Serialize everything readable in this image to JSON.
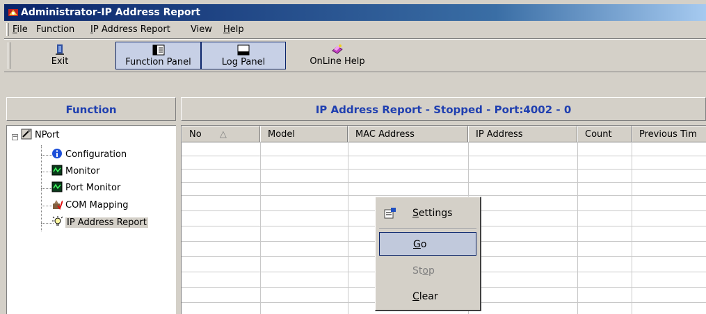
{
  "window": {
    "title": "Administrator-IP Address Report"
  },
  "menu": {
    "file": "File",
    "function": "Function",
    "ip_report": "IP Address Report",
    "view": "View",
    "help": "Help"
  },
  "toolbar": {
    "exit": "Exit",
    "function_panel": "Function Panel",
    "log_panel": "Log Panel",
    "online_help": "OnLine Help"
  },
  "left_panel": {
    "header": "Function"
  },
  "tree": {
    "root": "NPort",
    "items": [
      "Configuration",
      "Monitor",
      "Port Monitor",
      "COM Mapping",
      "IP Address Report"
    ]
  },
  "main": {
    "header": "IP Address Report - Stopped - Port:4002 - 0"
  },
  "grid": {
    "columns": [
      "No",
      "Model",
      "MAC Address",
      "IP Address",
      "Count",
      "Previous Tim"
    ],
    "sort_indicator": "△"
  },
  "context_menu": {
    "settings": "Settings",
    "go": "Go",
    "stop": "Stop",
    "clear": "Clear"
  }
}
